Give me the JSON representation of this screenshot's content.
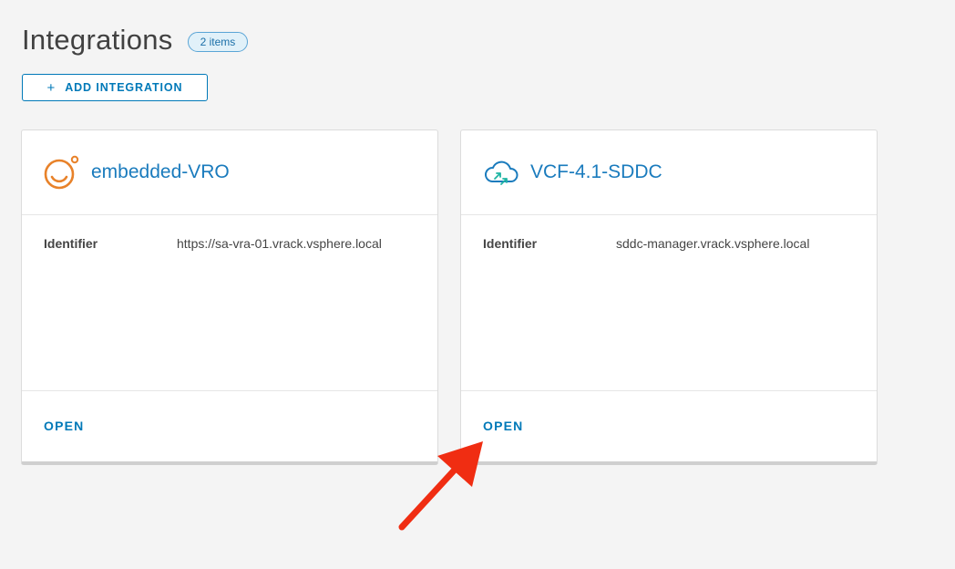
{
  "header": {
    "title": "Integrations",
    "count_badge": "2 items"
  },
  "toolbar": {
    "add_label": "ADD INTEGRATION",
    "add_icon": "plus-icon"
  },
  "cards": [
    {
      "title": "embedded-VRO",
      "icon": "vro-orbit-icon",
      "icon_color": "#e8822a",
      "property_label": "Identifier",
      "property_value": "https://sa-vra-01.vrack.vsphere.local",
      "action_label": "OPEN"
    },
    {
      "title": "VCF-4.1-SDDC",
      "icon": "cloud-arrows-icon",
      "icon_color": "#1a7bbd",
      "property_label": "Identifier",
      "property_value": "sddc-manager.vrack.vsphere.local",
      "action_label": "OPEN"
    }
  ],
  "annotation": {
    "arrow_color": "#f02d12",
    "arrow_icon": "red-arrow-icon"
  }
}
